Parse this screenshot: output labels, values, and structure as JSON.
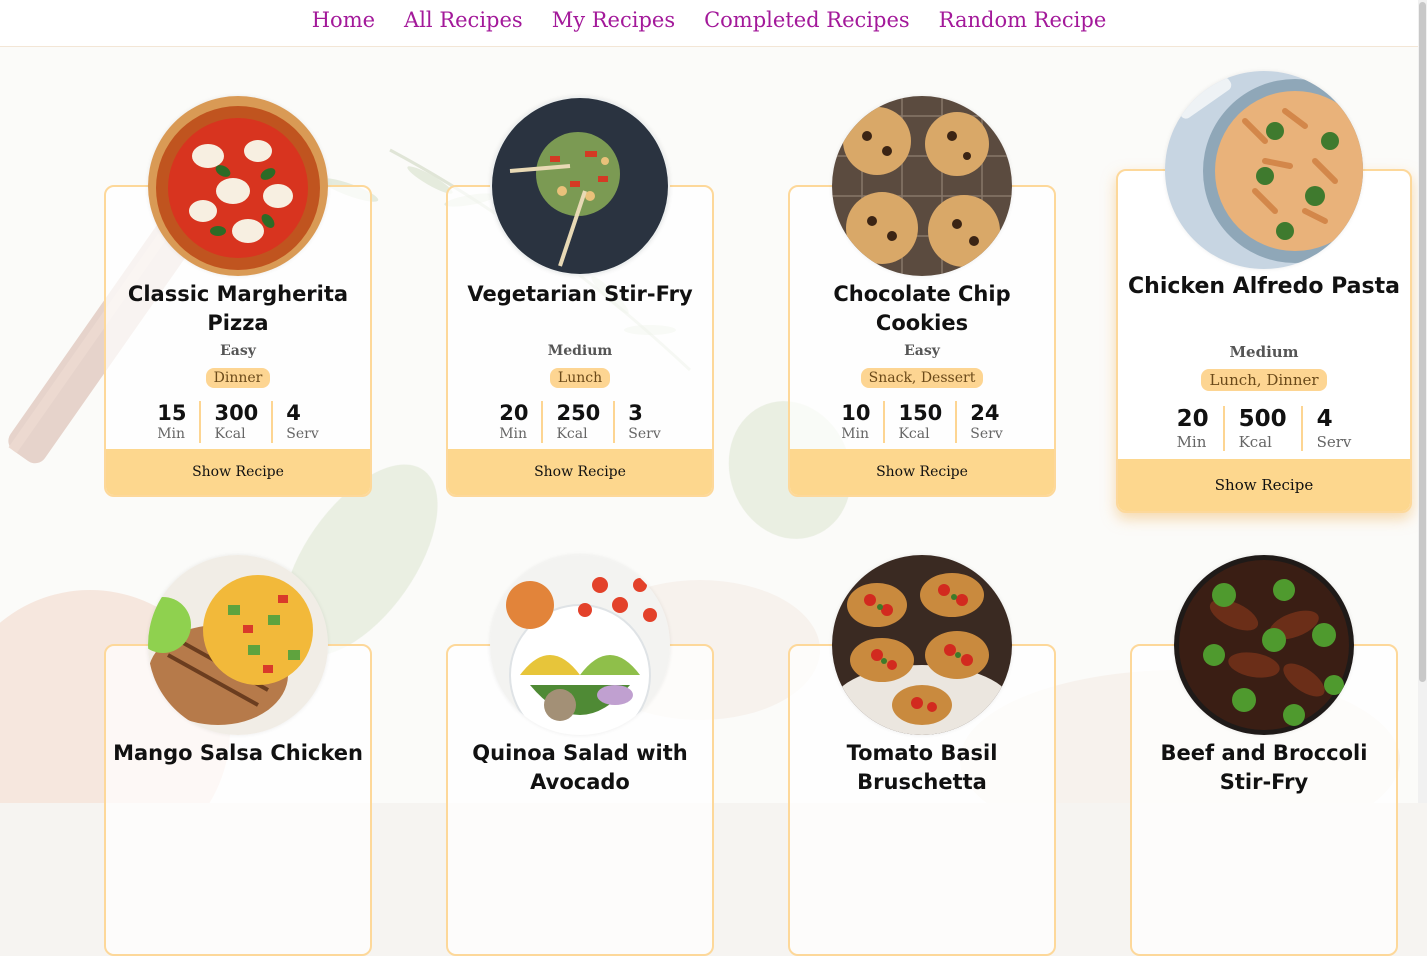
{
  "nav": {
    "items": [
      "Home",
      "All Recipes",
      "My Recipes",
      "Completed Recipes",
      "Random Recipe"
    ]
  },
  "recipes": [
    {
      "title": "Classic Margherita Pizza",
      "difficulty": "Easy",
      "tag": "Dinner",
      "min": "15",
      "kcal": "300",
      "serv": "4",
      "button": "Show Recipe",
      "photo_icon": "pizza-photo"
    },
    {
      "title": "Vegetarian Stir-Fry",
      "difficulty": "Medium",
      "tag": "Lunch",
      "min": "20",
      "kcal": "250",
      "serv": "3",
      "button": "Show Recipe",
      "photo_icon": "stir-fry-photo"
    },
    {
      "title": "Chocolate Chip Cookies",
      "difficulty": "Easy",
      "tag": "Snack, Dessert",
      "min": "10",
      "kcal": "150",
      "serv": "24",
      "button": "Show Recipe",
      "photo_icon": "cookies-photo"
    },
    {
      "title": "Chicken Alfredo Pasta",
      "difficulty": "Medium",
      "tag": "Lunch, Dinner",
      "min": "20",
      "kcal": "500",
      "serv": "4",
      "button": "Show Recipe",
      "photo_icon": "pasta-photo"
    },
    {
      "title": "Mango Salsa Chicken",
      "photo_icon": "chicken-photo"
    },
    {
      "title": "Quinoa Salad with Avocado",
      "photo_icon": "salad-photo"
    },
    {
      "title": "Tomato Basil Bruschetta",
      "photo_icon": "bruschetta-photo"
    },
    {
      "title": "Beef and Broccoli Stir-Fry",
      "photo_icon": "beef-broccoli-photo"
    }
  ],
  "units": {
    "min": "Min",
    "kcal": "Kcal",
    "serv": "Serv"
  },
  "colors": {
    "nav_link": "#a3199a",
    "card_border": "#fdd89a",
    "accent": "#fdd78e"
  }
}
